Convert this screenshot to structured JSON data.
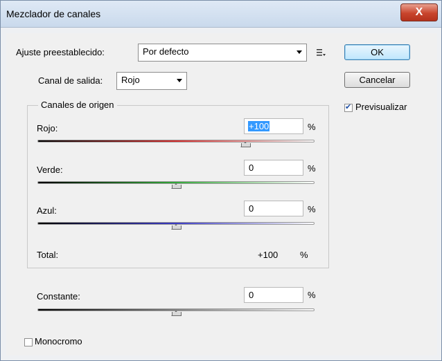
{
  "window": {
    "title": "Mezclador de canales",
    "close_symbol": "X"
  },
  "preset": {
    "label": "Ajuste preestablecido:",
    "value": "Por defecto"
  },
  "output": {
    "label": "Canal de salida:",
    "value": "Rojo"
  },
  "buttons": {
    "ok": "OK",
    "cancel": "Cancelar"
  },
  "preview": {
    "label": "Previsualizar",
    "checked": true
  },
  "source": {
    "title": "Canales de origen",
    "channels": [
      {
        "label": "Rojo:",
        "value": "+100",
        "unit": "%",
        "level": 100,
        "gradient": [
          "#000000",
          "#d42a2a",
          "#ffffff"
        ]
      },
      {
        "label": "Verde:",
        "value": "0",
        "unit": "%",
        "level": 0,
        "gradient": [
          "#000000",
          "#34a83a",
          "#ffffff"
        ]
      },
      {
        "label": "Azul:",
        "value": "0",
        "unit": "%",
        "level": 0,
        "gradient": [
          "#000000",
          "#3b3bc4",
          "#ffffff"
        ]
      }
    ],
    "total": {
      "label": "Total:",
      "value": "+100",
      "unit": "%"
    }
  },
  "constant": {
    "label": "Constante:",
    "value": "0",
    "unit": "%",
    "level": 0,
    "gradient": [
      "#000000",
      "#808080",
      "#ffffff"
    ]
  },
  "monochrome": {
    "label": "Monocromo",
    "checked": false
  }
}
